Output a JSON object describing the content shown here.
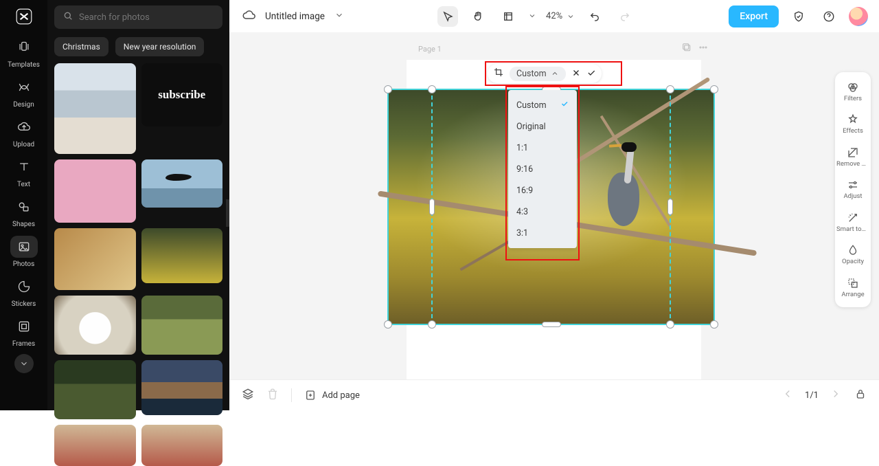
{
  "rail": {
    "items": [
      {
        "label": "Templates"
      },
      {
        "label": "Design"
      },
      {
        "label": "Upload"
      },
      {
        "label": "Text"
      },
      {
        "label": "Shapes"
      },
      {
        "label": "Photos"
      },
      {
        "label": "Stickers"
      },
      {
        "label": "Frames"
      }
    ]
  },
  "panel": {
    "search_placeholder": "Search for photos",
    "chips": [
      "Christmas",
      "New year resolution"
    ]
  },
  "topbar": {
    "title": "Untitled image",
    "zoom": "42%",
    "export": "Export"
  },
  "page": {
    "label": "Page 1"
  },
  "crop": {
    "selected": "Custom",
    "options": [
      "Custom",
      "Original",
      "1:1",
      "9:16",
      "16:9",
      "4:3",
      "3:1"
    ]
  },
  "proprail": {
    "items": [
      {
        "label": "Filters"
      },
      {
        "label": "Effects"
      },
      {
        "label": "Remove backgr..."
      },
      {
        "label": "Adjust"
      },
      {
        "label": "Smart tools"
      },
      {
        "label": "Opacity"
      },
      {
        "label": "Arrange"
      }
    ]
  },
  "bottombar": {
    "add_page": "Add page",
    "page_indicator": "1/1"
  },
  "colors": {
    "accent": "#29b8ff",
    "highlight": "#e11",
    "selection": "#41d3d9"
  }
}
